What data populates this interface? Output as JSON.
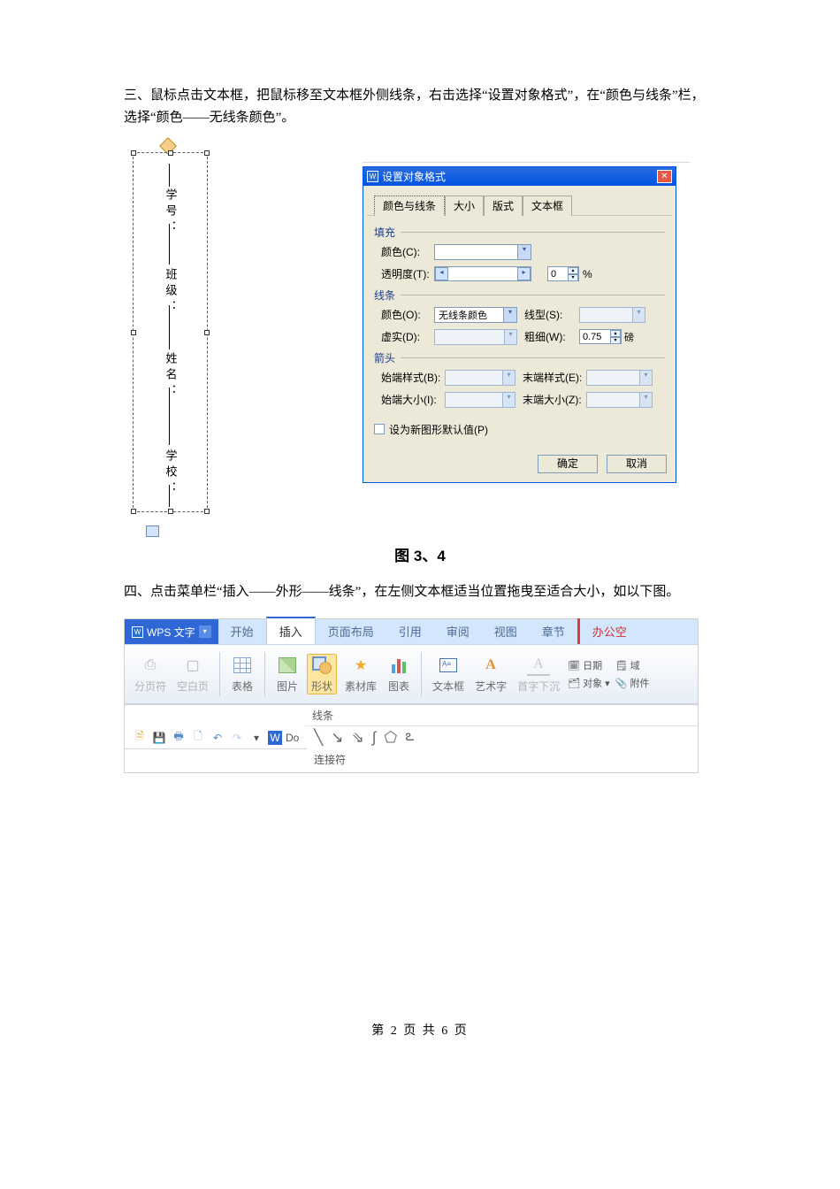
{
  "para1": "三、鼠标点击文本框，把鼠标移至文本框外侧线条，右击选择“设置对象格式”，在“颜色与线条”栏，选择“颜色——无线条颜色”。",
  "textbox_labels": {
    "l1": "学号：",
    "l2": "班级：",
    "l3": "姓名：",
    "l4": "学校："
  },
  "dialog": {
    "title": "设置对象格式",
    "tabs": {
      "t1": "颜色与线条",
      "t2": "大小",
      "t3": "版式",
      "t4": "文本框"
    },
    "fill_section": "填充",
    "fill_color_lbl": "颜色(C):",
    "trans_lbl": "透明度(T):",
    "trans_val": "0",
    "trans_unit": "%",
    "line_section": "线条",
    "line_color_lbl": "颜色(O):",
    "line_color_val": "无线条颜色",
    "line_style_lbl": "线型(S):",
    "dash_lbl": "虚实(D):",
    "weight_lbl": "粗细(W):",
    "weight_val": "0.75",
    "weight_unit": "磅",
    "arrow_section": "箭头",
    "begin_style_lbl": "始端样式(B):",
    "end_style_lbl": "末端样式(E):",
    "begin_size_lbl": "始端大小(I):",
    "end_size_lbl": "末端大小(Z):",
    "default_chk": "设为新图形默认值(P)",
    "ok": "确定",
    "cancel": "取消"
  },
  "caption": "图 3、4",
  "para2": "四、点击菜单栏“插入——外形——线条”，在左侧文本框适当位置拖曳至适合大小，如以下图。",
  "ribbon": {
    "brand": "WPS 文字",
    "tabs": [
      "开始",
      "插入",
      "页面布局",
      "引用",
      "审阅",
      "视图",
      "章节",
      "办公空"
    ],
    "active_tab_index": 1,
    "btns": {
      "pagebreak": "分页符",
      "blank": "空白页",
      "table": "表格",
      "pic": "图片",
      "shape": "形状",
      "asset": "素材库",
      "chart": "图表",
      "textbox": "文本框",
      "wordart": "艺术字",
      "dropcap": "首字下沉",
      "date": "日期",
      "domain": "域",
      "object": "对象",
      "attach": "附件"
    },
    "group_lines": "线条",
    "group_conn": "连接符",
    "doc_abbrev": "Do"
  },
  "page_footer": "第 2 页 共 6 页"
}
